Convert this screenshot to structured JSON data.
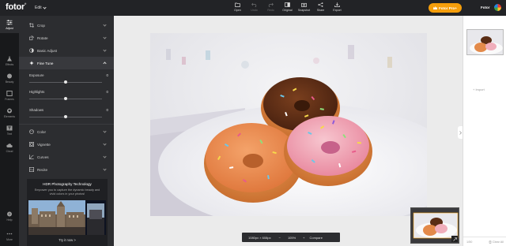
{
  "app": {
    "logo": "fotor",
    "edit_label": "Edit",
    "brand_right": "Fotor"
  },
  "toolbar": [
    {
      "label": "Open",
      "icon": "folder-icon",
      "enabled": true
    },
    {
      "label": "Undo",
      "icon": "undo-icon",
      "enabled": false
    },
    {
      "label": "Redo",
      "icon": "redo-icon",
      "enabled": false
    },
    {
      "label": "Original",
      "icon": "compare-icon",
      "enabled": true
    },
    {
      "label": "Snapshot",
      "icon": "snapshot-icon",
      "enabled": true
    },
    {
      "label": "Share",
      "icon": "share-icon",
      "enabled": true
    },
    {
      "label": "Export",
      "icon": "download-icon",
      "enabled": true
    }
  ],
  "pro_button": "Fotor Pro+",
  "rail": [
    {
      "label": "Adjust",
      "icon": "sliders-icon",
      "active": true
    },
    {
      "label": "Effects",
      "icon": "flask-icon",
      "active": false
    },
    {
      "label": "Beauty",
      "icon": "face-icon",
      "active": false
    },
    {
      "label": "Frames",
      "icon": "frame-icon",
      "active": false
    },
    {
      "label": "Elements",
      "icon": "heart-icon",
      "active": false
    },
    {
      "label": "Text",
      "icon": "text-icon",
      "active": false
    },
    {
      "label": "Cloud",
      "icon": "cloud-icon",
      "active": false
    }
  ],
  "rail_bottom": [
    {
      "label": "Help",
      "icon": "help-icon"
    },
    {
      "label": "More",
      "icon": "more-icon"
    }
  ],
  "panel": {
    "sections_top": [
      {
        "label": "Crop",
        "icon": "crop-icon"
      },
      {
        "label": "Rotate",
        "icon": "rotate-icon"
      },
      {
        "label": "Basic Adjust",
        "icon": "adjust-icon"
      }
    ],
    "open_section": {
      "label": "Fine Tune",
      "icon": "fine-tune-icon"
    },
    "sliders": [
      {
        "label": "Exposure",
        "value": "0",
        "level": 0.5
      },
      {
        "label": "Highlights",
        "value": "0",
        "level": 0.5
      },
      {
        "label": "Shadows",
        "value": "0",
        "level": 0.5
      }
    ],
    "sections_bottom": [
      {
        "label": "Color",
        "icon": "color-icon"
      },
      {
        "label": "Vignette",
        "icon": "vignette-icon"
      },
      {
        "label": "Curves",
        "icon": "curves-icon"
      },
      {
        "label": "Recite",
        "icon": "recite-icon"
      }
    ],
    "promo": {
      "title": "HDR Photography Technology",
      "text": "Empower you to capture the dynamic beauty and vivid colors in your photos!",
      "cta": "Try it now >"
    }
  },
  "canvas": {
    "dimensions": "1080px × 608px",
    "zoom": "105%",
    "compare": "Compare"
  },
  "right_panel": {
    "import": "+ Import",
    "count": "1/50",
    "clear": "Clear All"
  },
  "colors": {
    "accent": "#f59e0b",
    "topbar": "#222326",
    "panel": "#2c2d30"
  }
}
